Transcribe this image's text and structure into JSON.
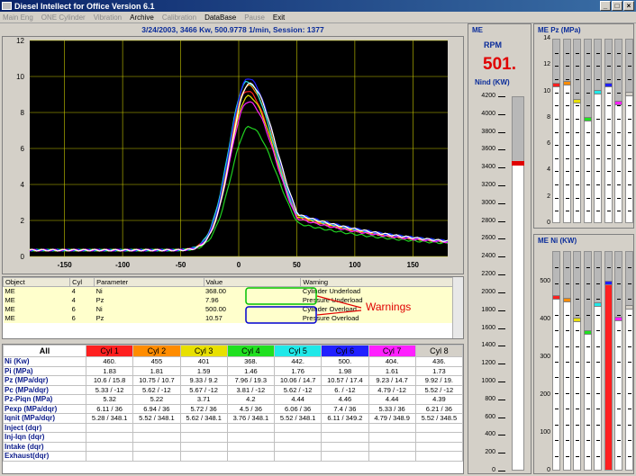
{
  "window": {
    "title": "Diesel Intellect for Office    Version 6.1"
  },
  "menu": [
    {
      "label": "Main Eng",
      "enabled": false
    },
    {
      "label": "ONE Cylinder",
      "enabled": false
    },
    {
      "label": "Vibration",
      "enabled": false
    },
    {
      "label": "Archive",
      "enabled": true
    },
    {
      "label": "Calibration",
      "enabled": false
    },
    {
      "label": "DataBase",
      "enabled": true
    },
    {
      "label": "Pause",
      "enabled": false
    },
    {
      "label": "Exit",
      "enabled": true
    }
  ],
  "info": "3/24/2003,  3466 Kw,   500.9778 1/min,   Session: 1377",
  "chart_data": {
    "type": "line",
    "xlim": [
      -180,
      180
    ],
    "ylim": [
      0,
      12
    ],
    "x_ticks": [
      "-150",
      "-100",
      "-50",
      "0",
      "50",
      "100",
      "150"
    ],
    "y_ticks": [
      "0",
      "2",
      "4",
      "6",
      "8",
      "10",
      "12"
    ],
    "grid": true,
    "peak_x": [
      7,
      8,
      8,
      9,
      7,
      8,
      8,
      9
    ],
    "series": [
      {
        "color": "#ff2020",
        "peak": 9.2
      },
      {
        "color": "#ff8c00",
        "peak": 9.5
      },
      {
        "color": "#e0e000",
        "peak": 8.9
      },
      {
        "color": "#20d020",
        "peak": 7.2
      },
      {
        "color": "#20e0e0",
        "peak": 9.7
      },
      {
        "color": "#2020ff",
        "peak": 9.9
      },
      {
        "color": "#ff20ff",
        "peak": 8.6
      },
      {
        "color": "#ffffff",
        "peak": 9.6
      }
    ]
  },
  "warnings": {
    "label": "Warnings",
    "columns": [
      "Object",
      "Cyl",
      "Parameter",
      "Value",
      "Warning"
    ],
    "rows": [
      [
        "ME",
        "4",
        "Ni",
        "368.00",
        "Cylinder Underload"
      ],
      [
        "ME",
        "4",
        "Pz",
        "7.96",
        "Pressure Underload"
      ],
      [
        "ME",
        "6",
        "Ni",
        "500.00",
        "Cylinder Overload"
      ],
      [
        "ME",
        "6",
        "Pz",
        "10.57",
        "Pressure Overload"
      ]
    ]
  },
  "table": {
    "corner": "All",
    "headers": [
      {
        "label": "Cyl 1",
        "color": "#ff2020"
      },
      {
        "label": "Cyl 2",
        "color": "#ff8c00"
      },
      {
        "label": "Cyl 3",
        "color": "#e8e000"
      },
      {
        "label": "Cyl 4",
        "color": "#20e020"
      },
      {
        "label": "Cyl 5",
        "color": "#20e8e8"
      },
      {
        "label": "Cyl 6",
        "color": "#2020ff"
      },
      {
        "label": "Cyl 7",
        "color": "#ff20ff"
      },
      {
        "label": "Cyl 8",
        "color": "#d4d0c8"
      }
    ],
    "rows": [
      {
        "label": "Ni    (Kw)",
        "values": [
          "460.",
          "455",
          "401",
          "368.",
          "442.",
          "500.",
          "404.",
          "436."
        ]
      },
      {
        "label": "Pi    (MPa)",
        "values": [
          "1.83",
          "1.81",
          "1.59",
          "1.46",
          "1.76",
          "1.98",
          "1.61",
          "1.73"
        ]
      },
      {
        "label": "Pz     (MPa/dqr)",
        "values": [
          "10.6 / 15.8",
          "10.75 / 10.7",
          "9.33 / 9.2",
          "7.96 / 19.3",
          "10.06 / 14.7",
          "10.57 / 17.4",
          "9.23 / 14.7",
          "9.92 / 19."
        ]
      },
      {
        "label": "Pc     (MPa/dqr)",
        "values": [
          "5.33 / -12",
          "5.62 / -12",
          "5.67 / -12",
          "3.81 / -12",
          "5.62 / -12",
          "6. / -12",
          "4.79 / -12",
          "5.52 / -12"
        ]
      },
      {
        "label": "Pz-Piqn    (MPa)",
        "values": [
          "5.32",
          "5.22",
          "3.71",
          "4.2",
          "4.44",
          "4.46",
          "4.44",
          "4.39"
        ]
      },
      {
        "label": "Pexp   (MPa/dqr)",
        "values": [
          "6.11 / 36",
          "6.94 / 36",
          "5.72 / 36",
          "4.5 / 36",
          "6.06 / 36",
          "7.4 / 36",
          "5.33 / 36",
          "6.21 / 36"
        ]
      },
      {
        "label": "Iqnit  (MPa/dqr)",
        "values": [
          "5.28 / 348.1",
          "5.52 / 348.1",
          "5.62 / 348.1",
          "3.76 / 348.1",
          "5.52 / 348.1",
          "6.11 / 349.2",
          "4.79 / 348.9",
          "5.52 / 348.5"
        ]
      },
      {
        "label": "Inject (dqr)",
        "values": [
          "",
          "",
          "",
          "",
          "",
          "",
          "",
          ""
        ]
      },
      {
        "label": "Inj-Iqn (dqr)",
        "values": [
          "",
          "",
          "",
          "",
          "",
          "",
          "",
          ""
        ]
      },
      {
        "label": "Intake (dqr)",
        "values": [
          "",
          "",
          "",
          "",
          "",
          "",
          "",
          ""
        ]
      },
      {
        "label": "Exhaust(dqr)",
        "values": [
          "",
          "",
          "",
          "",
          "",
          "",
          "",
          ""
        ]
      }
    ]
  },
  "me_panel": {
    "title": "ME",
    "rpm_label": "RPM",
    "rpm_value": "501.",
    "nind_label": "Nind (KW)",
    "scale": [
      "4200",
      "4000",
      "3800",
      "3600",
      "3400",
      "3200",
      "3000",
      "2800",
      "2600",
      "2400",
      "2200",
      "2000",
      "1800",
      "1600",
      "1400",
      "1200",
      "1000",
      "800",
      "600",
      "400",
      "200",
      "0"
    ],
    "max": 4200,
    "value": 3466
  },
  "pz_panel": {
    "title": "ME Pz  (MPa)",
    "scale": [
      "14",
      "12",
      "10",
      "8",
      "6",
      "4",
      "2",
      "0"
    ],
    "max": 14,
    "values": [
      10.6,
      10.75,
      9.33,
      7.96,
      10.06,
      10.57,
      9.23,
      9.92
    ],
    "colors": [
      "#ff2020",
      "#ff8c00",
      "#e8e000",
      "#20e020",
      "#20e8e8",
      "#2020ff",
      "#ff20ff",
      "#d4d0c8"
    ]
  },
  "ni_panel": {
    "title": "ME Ni  (KW)",
    "scale": [
      "500",
      "400",
      "300",
      "200",
      "100",
      "0"
    ],
    "max": 580,
    "values": [
      460,
      455,
      401,
      368,
      442,
      500,
      404,
      436
    ],
    "colors": [
      "#ff2020",
      "#ff8c00",
      "#e8e000",
      "#20e020",
      "#20e8e8",
      "#2020ff",
      "#ff20ff",
      "#d4d0c8"
    ]
  }
}
